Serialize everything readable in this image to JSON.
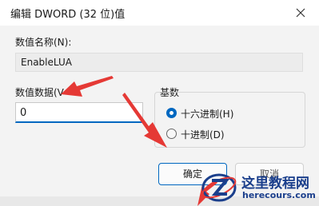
{
  "window": {
    "title": "编辑 DWORD (32 位)值",
    "close_icon": "close-icon"
  },
  "value_name": {
    "label": "数值名称(N):",
    "value": "EnableLUA"
  },
  "value_data": {
    "label": "数值数据(V",
    "value": "0"
  },
  "base": {
    "label": "基数",
    "options": [
      {
        "label": "十六进制(H)",
        "selected": true
      },
      {
        "label": "十进制(D)",
        "selected": false
      }
    ]
  },
  "buttons": {
    "ok": "确定",
    "cancel": "取消"
  },
  "watermark": {
    "title": "这里教程网",
    "url": "herecours.com",
    "logo": "Z-logo"
  },
  "annotations": {
    "arrow_color": "#e53935"
  },
  "colors": {
    "accent": "#0067c0",
    "arrow": "#e53935",
    "watermark": "#1b3f8c"
  }
}
